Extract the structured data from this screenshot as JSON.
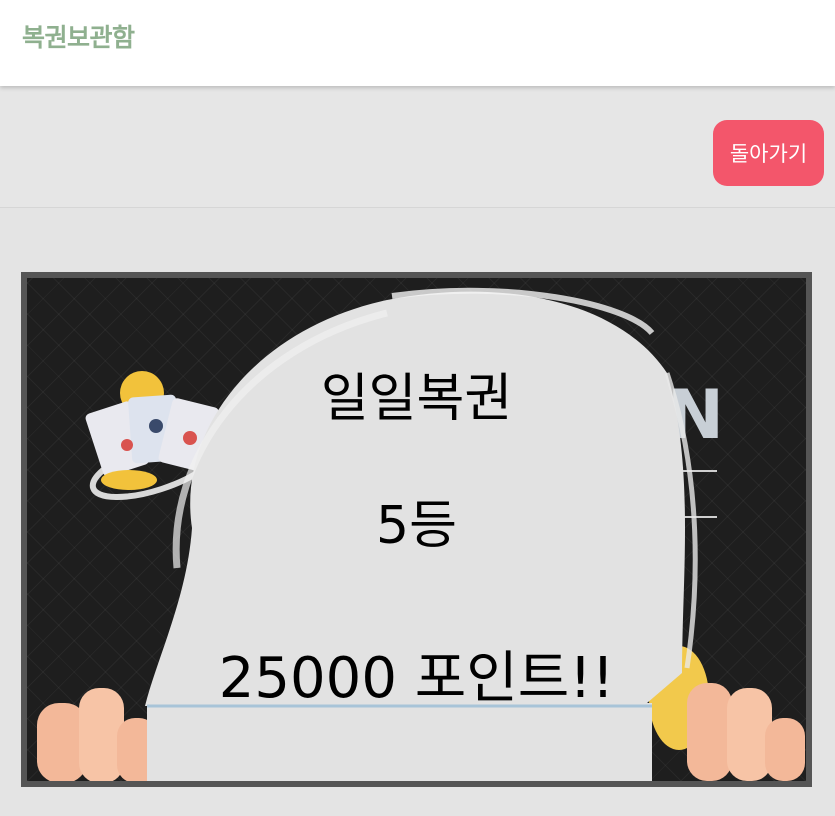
{
  "header": {
    "title": "복권보관함"
  },
  "actions": {
    "back_label": "돌아가기"
  },
  "ticket": {
    "name": "일일복권",
    "rank": "5등",
    "prize": "25000 포인트!!"
  },
  "colors": {
    "title": "#8fb08f",
    "back_button": "#f3566b",
    "background": "#e6e6e6",
    "ticket_bg": "#1e1e1e",
    "scratch_area": "#e2e2e2"
  }
}
